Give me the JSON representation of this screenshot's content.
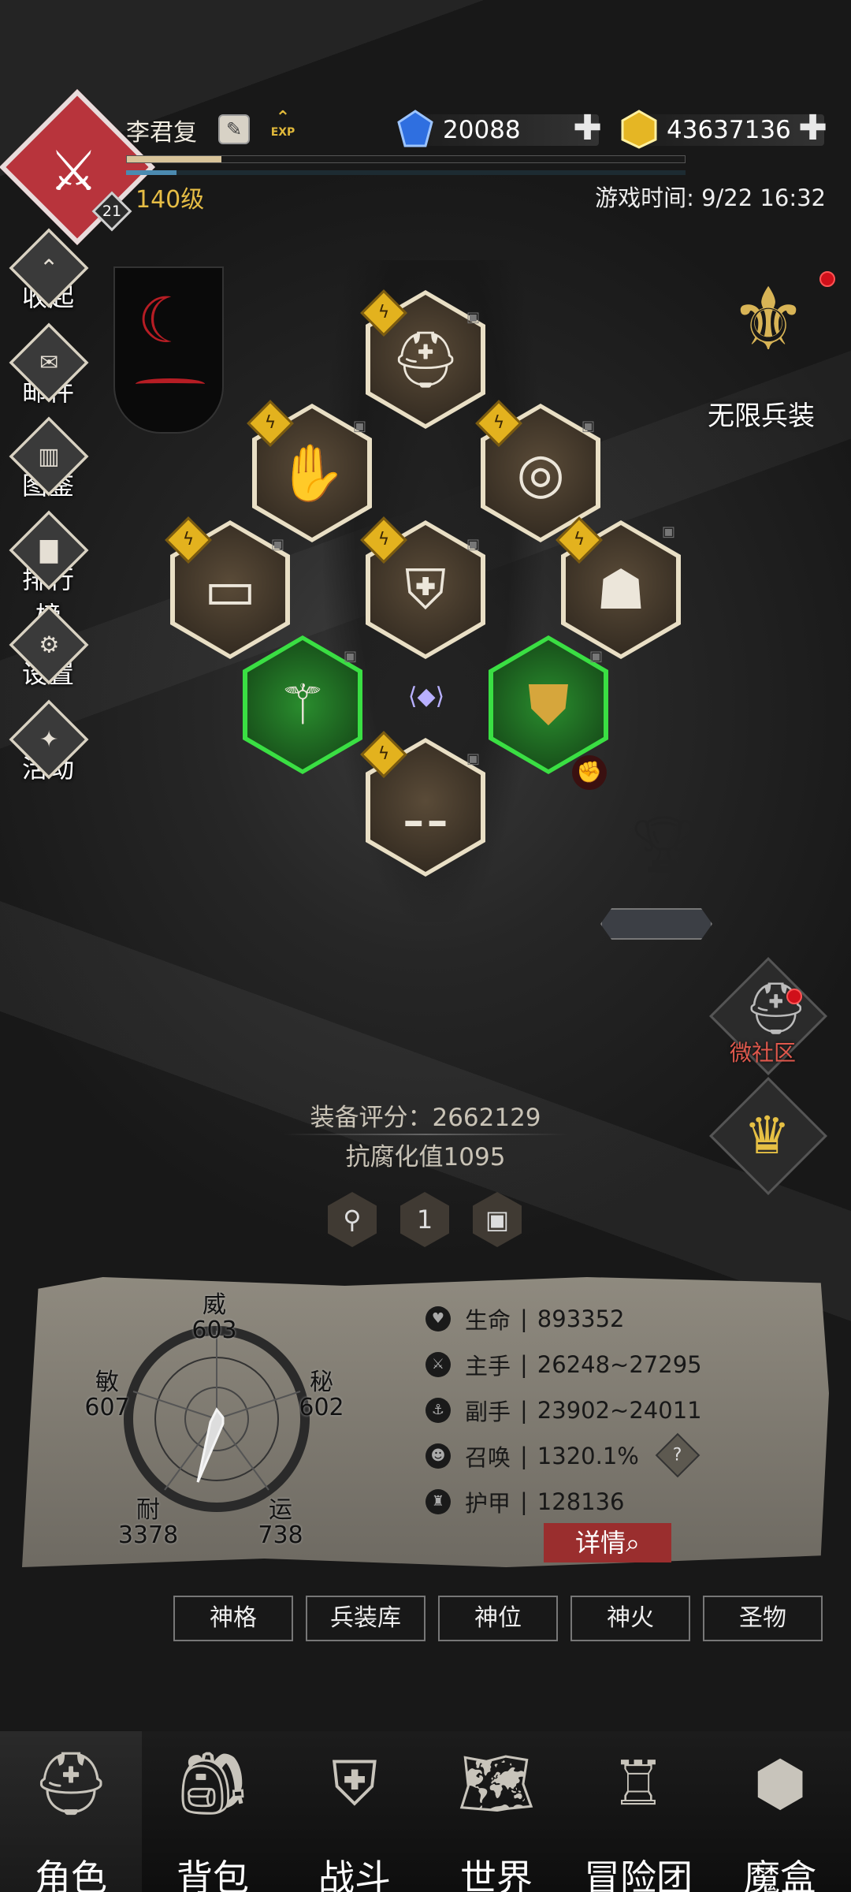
{
  "player": {
    "name": "李君复",
    "rank_badge": "21",
    "level_text": "140级",
    "exp_label": "EXP",
    "exp_progress": 0.17,
    "mp_progress": 0.09
  },
  "currency": {
    "diamonds": "20088",
    "gold": "43637136",
    "plus": "✚"
  },
  "game_time": "游戏时间: 9/22 16:32",
  "left_menu": [
    {
      "label": "收起",
      "icon": "collapse-icon"
    },
    {
      "label": "邮件",
      "icon": "mail-icon"
    },
    {
      "label": "图鉴",
      "icon": "book-icon"
    },
    {
      "label": "排行榜",
      "icon": "ranking-icon"
    },
    {
      "label": "设置",
      "icon": "gear-icon"
    },
    {
      "label": "活动",
      "icon": "event-icon"
    }
  ],
  "right_menu": {
    "unlimited": "无限兵装",
    "community": "微社区"
  },
  "equipment": {
    "score": "装备评分：2662129",
    "resist": "抗腐化值1095",
    "pips": [
      "",
      "1",
      ""
    ]
  },
  "stats": {
    "wei": {
      "label": "威",
      "value": "603"
    },
    "min": {
      "label": "敏",
      "value": "607"
    },
    "mi": {
      "label": "秘",
      "value": "602"
    },
    "nai": {
      "label": "耐",
      "value": "3378"
    },
    "yun": {
      "label": "运",
      "value": "738"
    }
  },
  "attributes": [
    {
      "name": "生命",
      "value": "893352",
      "icon": "heart-icon"
    },
    {
      "name": "主手",
      "value": "26248~27295",
      "icon": "sword-icon"
    },
    {
      "name": "副手",
      "value": "23902~24011",
      "icon": "dagger-icon"
    },
    {
      "name": "召唤",
      "value": "1320.1%",
      "icon": "summon-icon"
    },
    {
      "name": "护甲",
      "value": "128136",
      "icon": "armor-icon"
    }
  ],
  "attr_sep": "|",
  "help": "?",
  "detail_button": "详情",
  "tabs": [
    "神格",
    "兵装库",
    "神位",
    "神火",
    "圣物"
  ],
  "bottom_nav": [
    "角色",
    "背包",
    "战斗",
    "世界",
    "冒险团",
    "魔盒"
  ],
  "colors": {
    "gold": "#e6bd45",
    "red": "#b8343c",
    "green": "#3adf43"
  }
}
